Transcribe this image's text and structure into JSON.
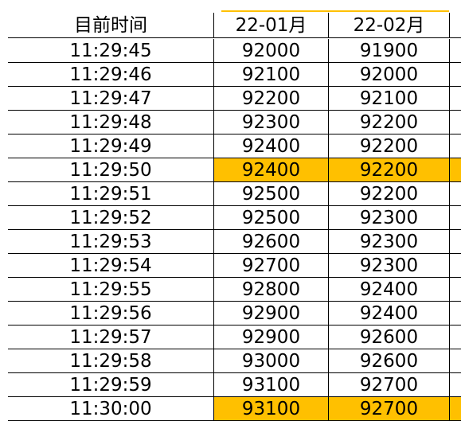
{
  "headers": [
    "目前时间",
    "22-01月",
    "22-02月"
  ],
  "highlight_color": "#ffc000",
  "rows": [
    {
      "time": "11:29:45",
      "m1": "92000",
      "m2": "91900",
      "highlight": false
    },
    {
      "time": "11:29:46",
      "m1": "92100",
      "m2": "92000",
      "highlight": false
    },
    {
      "time": "11:29:47",
      "m1": "92200",
      "m2": "92100",
      "highlight": false
    },
    {
      "time": "11:29:48",
      "m1": "92300",
      "m2": "92200",
      "highlight": false
    },
    {
      "time": "11:29:49",
      "m1": "92400",
      "m2": "92200",
      "highlight": false
    },
    {
      "time": "11:29:50",
      "m1": "92400",
      "m2": "92200",
      "highlight": true
    },
    {
      "time": "11:29:51",
      "m1": "92500",
      "m2": "92200",
      "highlight": false
    },
    {
      "time": "11:29:52",
      "m1": "92500",
      "m2": "92300",
      "highlight": false
    },
    {
      "time": "11:29:53",
      "m1": "92600",
      "m2": "92300",
      "highlight": false
    },
    {
      "time": "11:29:54",
      "m1": "92700",
      "m2": "92300",
      "highlight": false
    },
    {
      "time": "11:29:55",
      "m1": "92800",
      "m2": "92400",
      "highlight": false
    },
    {
      "time": "11:29:56",
      "m1": "92900",
      "m2": "92400",
      "highlight": false
    },
    {
      "time": "11:29:57",
      "m1": "92900",
      "m2": "92600",
      "highlight": false
    },
    {
      "time": "11:29:58",
      "m1": "93000",
      "m2": "92600",
      "highlight": false
    },
    {
      "time": "11:29:59",
      "m1": "93100",
      "m2": "92700",
      "highlight": false
    },
    {
      "time": "11:30:00",
      "m1": "93100",
      "m2": "92700",
      "highlight": true
    }
  ]
}
